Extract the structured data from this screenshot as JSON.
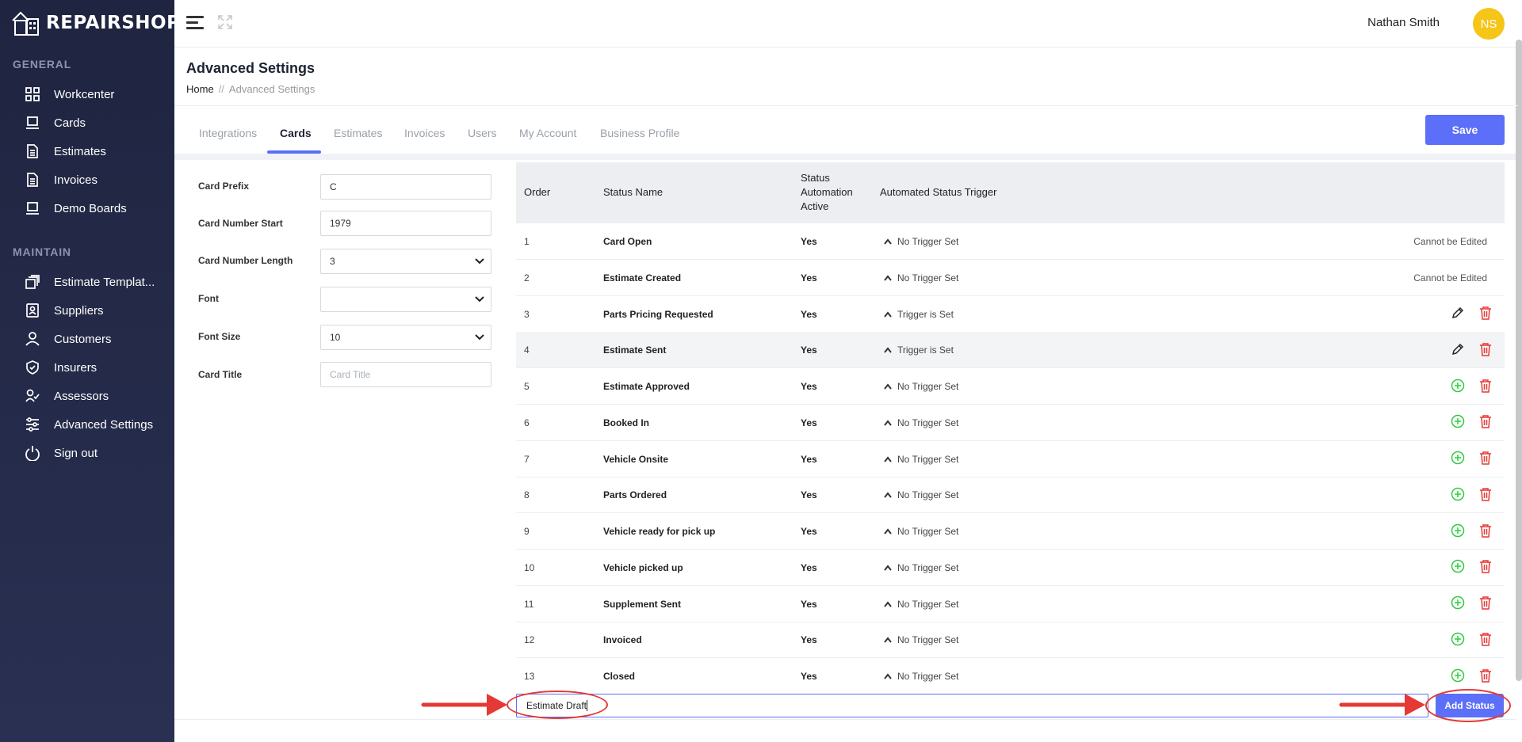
{
  "app": {
    "logo_text": "REPAIRSHOP"
  },
  "sidebar": {
    "sections": [
      {
        "title": "GENERAL",
        "items": [
          {
            "label": "Workcenter",
            "icon": "grid-icon"
          },
          {
            "label": "Cards",
            "icon": "laptop-icon"
          },
          {
            "label": "Estimates",
            "icon": "document-icon"
          },
          {
            "label": "Invoices",
            "icon": "document-icon"
          },
          {
            "label": "Demo Boards",
            "icon": "laptop-icon"
          }
        ]
      },
      {
        "title": "MAINTAIN",
        "items": [
          {
            "label": "Estimate Templat...",
            "icon": "stack-icon"
          },
          {
            "label": "Suppliers",
            "icon": "id-card-icon"
          },
          {
            "label": "Customers",
            "icon": "user-icon"
          },
          {
            "label": "Insurers",
            "icon": "shield-icon"
          },
          {
            "label": "Assessors",
            "icon": "user-check-icon"
          },
          {
            "label": "Advanced Settings",
            "icon": "sliders-icon"
          },
          {
            "label": "Sign out",
            "icon": "power-icon"
          }
        ]
      }
    ]
  },
  "topbar": {
    "user_name": "Nathan Smith",
    "user_initials": "NS",
    "avatar_color": "#f5c518"
  },
  "header": {
    "title": "Advanced Settings",
    "breadcrumb_home": "Home",
    "breadcrumb_sep": "//",
    "breadcrumb_current": "Advanced Settings"
  },
  "tabs": [
    {
      "label": "Integrations",
      "active": false
    },
    {
      "label": "Cards",
      "active": true
    },
    {
      "label": "Estimates",
      "active": false
    },
    {
      "label": "Invoices",
      "active": false
    },
    {
      "label": "Users",
      "active": false
    },
    {
      "label": "My Account",
      "active": false
    },
    {
      "label": "Business Profile",
      "active": false
    }
  ],
  "save_label": "Save",
  "form": {
    "card_prefix": {
      "label": "Card Prefix",
      "value": "C"
    },
    "card_number_start": {
      "label": "Card Number Start",
      "value": "1979"
    },
    "card_number_length": {
      "label": "Card Number Length",
      "value": "3"
    },
    "font": {
      "label": "Font",
      "value": ""
    },
    "font_size": {
      "label": "Font Size",
      "value": "10"
    },
    "card_title": {
      "label": "Card Title",
      "placeholder": "Card Title"
    }
  },
  "table": {
    "headers": {
      "order": "Order",
      "status_name": "Status Name",
      "automation_l1": "Status",
      "automation_l2": "Automation",
      "automation_l3": "Active",
      "trigger": "Automated Status Trigger"
    },
    "rows": [
      {
        "order": "1",
        "name": "Card Open",
        "active": "Yes",
        "trigger": "No Trigger Set",
        "note": "Cannot be Edited"
      },
      {
        "order": "2",
        "name": "Estimate Created",
        "active": "Yes",
        "trigger": "No Trigger Set",
        "note": "Cannot be Edited"
      },
      {
        "order": "3",
        "name": "Parts Pricing Requested",
        "active": "Yes",
        "trigger": "Trigger is Set",
        "action": "edit"
      },
      {
        "order": "4",
        "name": "Estimate Sent",
        "active": "Yes",
        "trigger": "Trigger is Set",
        "action": "edit"
      },
      {
        "order": "5",
        "name": "Estimate Approved",
        "active": "Yes",
        "trigger": "No Trigger Set",
        "action": "add"
      },
      {
        "order": "6",
        "name": "Booked In",
        "active": "Yes",
        "trigger": "No Trigger Set",
        "action": "add"
      },
      {
        "order": "7",
        "name": "Vehicle Onsite",
        "active": "Yes",
        "trigger": "No Trigger Set",
        "action": "add"
      },
      {
        "order": "8",
        "name": "Parts Ordered",
        "active": "Yes",
        "trigger": "No Trigger Set",
        "action": "add"
      },
      {
        "order": "9",
        "name": "Vehicle ready for pick up",
        "active": "Yes",
        "trigger": "No Trigger Set",
        "action": "add"
      },
      {
        "order": "10",
        "name": "Vehicle picked up",
        "active": "Yes",
        "trigger": "No Trigger Set",
        "action": "add"
      },
      {
        "order": "11",
        "name": "Supplement Sent",
        "active": "Yes",
        "trigger": "No Trigger Set",
        "action": "add"
      },
      {
        "order": "12",
        "name": "Invoiced",
        "active": "Yes",
        "trigger": "No Trigger Set",
        "action": "add"
      },
      {
        "order": "13",
        "name": "Closed",
        "active": "Yes",
        "trigger": "No Trigger Set",
        "action": "add"
      }
    ]
  },
  "add_status": {
    "value": "Estimate Draft",
    "button_label": "Add Status"
  },
  "colors": {
    "accent": "#5b6ff8",
    "delete": "#e53935",
    "add": "#2ecc40",
    "annotation": "#e53935"
  }
}
